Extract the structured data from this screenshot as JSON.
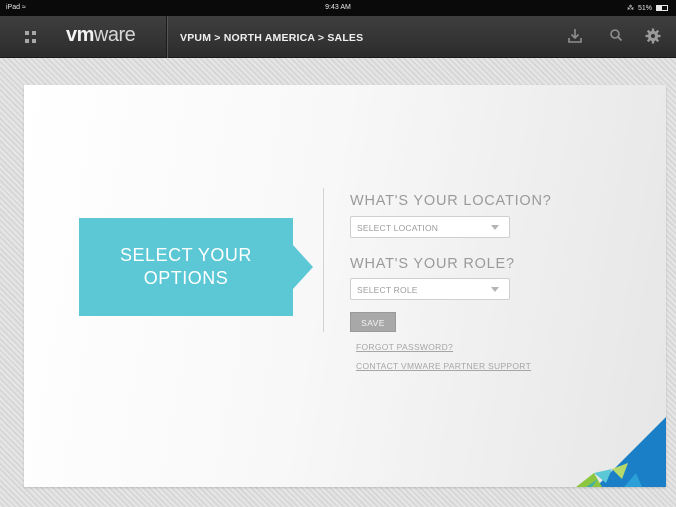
{
  "status_bar": {
    "device": "iPad",
    "time": "9:43 AM",
    "battery": "51%",
    "battery_fraction": 0.51
  },
  "toolbar": {
    "logo_vm": "vm",
    "logo_ware": "ware",
    "breadcrumb": "VPUM > NORTH AMERICA > SALES",
    "icons": [
      "apps-grid-icon",
      "download-icon",
      "search-icon",
      "settings-gear-icon"
    ]
  },
  "callout": {
    "line1": "SELECT YOUR",
    "line2": "OPTIONS"
  },
  "form": {
    "location_heading": "WHAT'S YOUR LOCATION?",
    "location_placeholder": "SELECT LOCATION",
    "role_heading": "WHAT'S YOUR ROLE?",
    "role_placeholder": "SELECT ROLE",
    "save_label": "SAVE",
    "forgot_password": "FORGOT PASSWORD?",
    "contact_support": "CONTACT VMWARE PARTNER SUPPORT"
  },
  "colors": {
    "accent": "#5cc8d6",
    "toolbar": "#333333",
    "corner_blue": "#1a7fc6",
    "corner_green": "#8cc63f"
  }
}
